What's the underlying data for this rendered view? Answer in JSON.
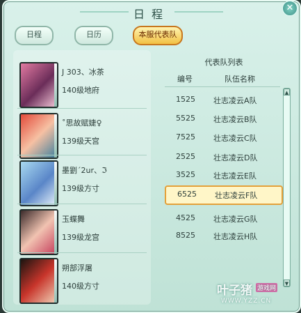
{
  "window": {
    "title": "日程",
    "close_icon": "close-icon"
  },
  "tabs": [
    {
      "label": "日程",
      "active": false
    },
    {
      "label": "日历",
      "active": false
    },
    {
      "label": "本服代表队",
      "active": true
    }
  ],
  "players": [
    {
      "name": "J 303、冰茶",
      "level": "140级地府"
    },
    {
      "name": "˚思故赋婕♀",
      "level": "139级天宫"
    },
    {
      "name": "墨劉´2ur、ℑ",
      "level": "139级方寸"
    },
    {
      "name": "玉蝶舞",
      "level": "139级龙宫"
    },
    {
      "name": "朔部浮屠",
      "level": "140级方寸"
    }
  ],
  "teams": {
    "title": "代表队列表",
    "col_num": "编号",
    "col_name": "队伍名称",
    "rows": [
      {
        "num": "1525",
        "name": "壮志凌云A队"
      },
      {
        "num": "5525",
        "name": "壮志凌云B队"
      },
      {
        "num": "7525",
        "name": "壮志凌云C队"
      },
      {
        "num": "2525",
        "name": "壮志凌云D队"
      },
      {
        "num": "3525",
        "name": "壮志凌云E队"
      },
      {
        "num": "6525",
        "name": "壮志凌云F队",
        "selected": true
      },
      {
        "num": "4525",
        "name": "壮志凌云G队"
      },
      {
        "num": "8525",
        "name": "壮志凌云H队"
      }
    ]
  },
  "watermark": {
    "logo": "叶子猪",
    "badge": "游戏网",
    "url": "WWW.YZZ.CN"
  }
}
